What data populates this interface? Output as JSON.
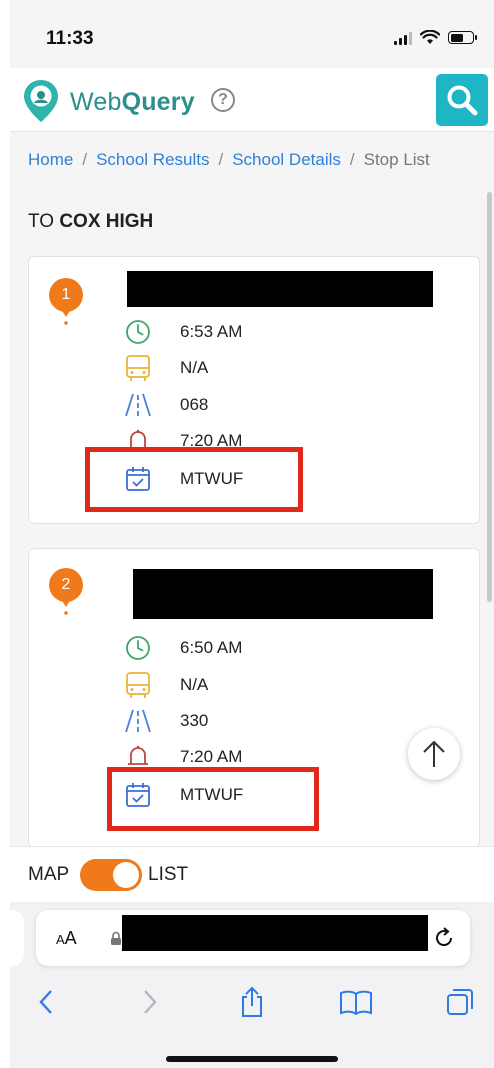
{
  "status_bar": {
    "time": "11:33"
  },
  "header": {
    "brand_web": "Web",
    "brand_query": "Query",
    "help_symbol": "?"
  },
  "breadcrumb": {
    "items": [
      "Home",
      "School Results",
      "School Details"
    ],
    "separator": "/",
    "current": "Stop List"
  },
  "heading": {
    "prefix": "TO",
    "school": "COX HIGH"
  },
  "stops": [
    {
      "number": "1",
      "pickup_time": "6:53 AM",
      "bus": "N/A",
      "route": "068",
      "bell_time": "7:20 AM",
      "days": "MTWUF"
    },
    {
      "number": "2",
      "pickup_time": "6:50 AM",
      "bus": "N/A",
      "route": "330",
      "bell_time": "7:20 AM",
      "days": "MTWUF"
    }
  ],
  "view_toggle": {
    "map_label": "MAP",
    "list_label": "LIST",
    "selected": "LIST"
  },
  "browser": {
    "text_size_label_small": "A",
    "text_size_label_large": "A"
  },
  "colors": {
    "accent_teal": "#1eb6c5",
    "brand_teal": "#2b8f8d",
    "pin_orange": "#f07a1a",
    "highlight_red": "#e0281c",
    "link_blue": "#2f80d6"
  }
}
